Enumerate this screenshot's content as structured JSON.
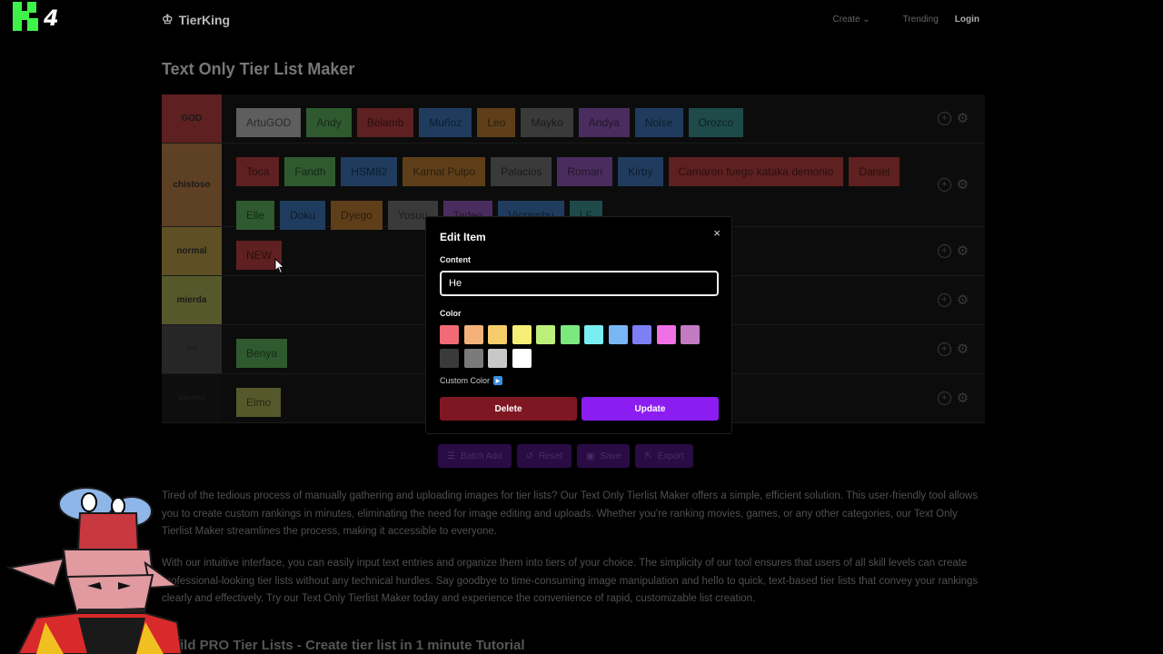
{
  "app": {
    "brand": "TierKing"
  },
  "nav": {
    "create": "Create",
    "trending": "Trending",
    "login": "Login"
  },
  "page": {
    "title": "Text Only Tier List Maker"
  },
  "tiers": [
    {
      "label": "GOD",
      "color": "#5e2020",
      "items": [
        {
          "text": "ArtuGOD",
          "color": "#5e5e5e"
        },
        {
          "text": "Andy",
          "color": "#2f5a2f"
        },
        {
          "text": "Belamb",
          "color": "#5e2020"
        },
        {
          "text": "Muñoz",
          "color": "#1f3c5e"
        },
        {
          "text": "Leo",
          "color": "#5e3f1a"
        },
        {
          "text": "Mayko",
          "color": "#3a3a3a"
        },
        {
          "text": "Andya",
          "color": "#4a2d5e"
        },
        {
          "text": "Noise",
          "color": "#1f3c5e"
        },
        {
          "text": "Orozco",
          "color": "#1f4a4a"
        }
      ]
    },
    {
      "label": "chistoso",
      "color": "#5e4024",
      "items": [
        {
          "text": "Toca",
          "color": "#5e2020"
        },
        {
          "text": "Fandh",
          "color": "#2f5a2f"
        },
        {
          "text": "HSM82",
          "color": "#1f3c5e"
        },
        {
          "text": "Karnal Pulpo",
          "color": "#5e3f1a"
        },
        {
          "text": "Palacios",
          "color": "#3a3a3a"
        },
        {
          "text": "Roman",
          "color": "#4a2d5e"
        },
        {
          "text": "Kirby",
          "color": "#1f3c5e"
        },
        {
          "text": "Camaron fuego kataka demonio",
          "color": "#5e2020"
        },
        {
          "text": "Daniel",
          "color": "#5e2020"
        },
        {
          "text": "Elle",
          "color": "#2f5a2f"
        },
        {
          "text": "Doku",
          "color": "#1f3c5e"
        },
        {
          "text": "Dyego",
          "color": "#5e3f1a"
        },
        {
          "text": "Yosuu",
          "color": "#3a3a3a"
        },
        {
          "text": "Tadeo",
          "color": "#4a2d5e"
        },
        {
          "text": "Vicrambu",
          "color": "#1f3c5e"
        },
        {
          "text": "LF",
          "color": "#1f4a4a"
        }
      ]
    },
    {
      "label": "normal",
      "color": "#5e5024",
      "items": [
        {
          "text": "NEW",
          "color": "#5e2020"
        }
      ]
    },
    {
      "label": "mierda",
      "color": "#55582a",
      "items": []
    },
    {
      "label": "==",
      "color": "#262626",
      "items": [
        {
          "text": "Benya",
          "color": "#2f5a2f"
        }
      ]
    },
    {
      "label": "menni",
      "color": "#0e0e0e",
      "items": [
        {
          "text": "Elmo",
          "color": "#55582a"
        }
      ]
    }
  ],
  "actions": {
    "batch_add": "Batch Add",
    "reset": "Reset",
    "save": "Save",
    "export": "Export"
  },
  "description": {
    "p1": "Tired of the tedious process of manually gathering and uploading images for tier lists? Our Text Only Tierlist Maker offers a simple, efficient solution. This user-friendly tool allows you to create custom rankings in minutes, eliminating the need for image editing and uploads. Whether you're ranking movies, games, or any other categories, our Text Only Tierlist Maker streamlines the process, making it accessible to everyone.",
    "p2": "With our intuitive interface, you can easily input text entries and organize them into tiers of your choice. The simplicity of our tool ensures that users of all skill levels can create professional-looking tier lists without any technical hurdles. Say goodbye to time-consuming image manipulation and hello to quick, text-based tier lists that convey your rankings clearly and effectively. Try our Text Only Tierlist Maker today and experience the convenience of rapid, customizable list creation.",
    "subhead": "Build PRO Tier Lists - Create tier list in 1 minute Tutorial"
  },
  "modal": {
    "title": "Edit Item",
    "close": "×",
    "content_label": "Content",
    "content_value": "He",
    "color_label": "Color",
    "swatches": [
      "#f06b75",
      "#f4b27a",
      "#f7cd6b",
      "#f7ee77",
      "#bdf07a",
      "#7de87d",
      "#79eef0",
      "#78b6f5",
      "#7e7ef5",
      "#f070e5",
      "#c27ac2",
      "#3a3a3a",
      "#7a7a7a",
      "#c8c8c8",
      "#ffffff"
    ],
    "custom_color_label": "Custom Color",
    "delete_label": "Delete",
    "update_label": "Update"
  },
  "overlay": {
    "logo_number": "4"
  }
}
